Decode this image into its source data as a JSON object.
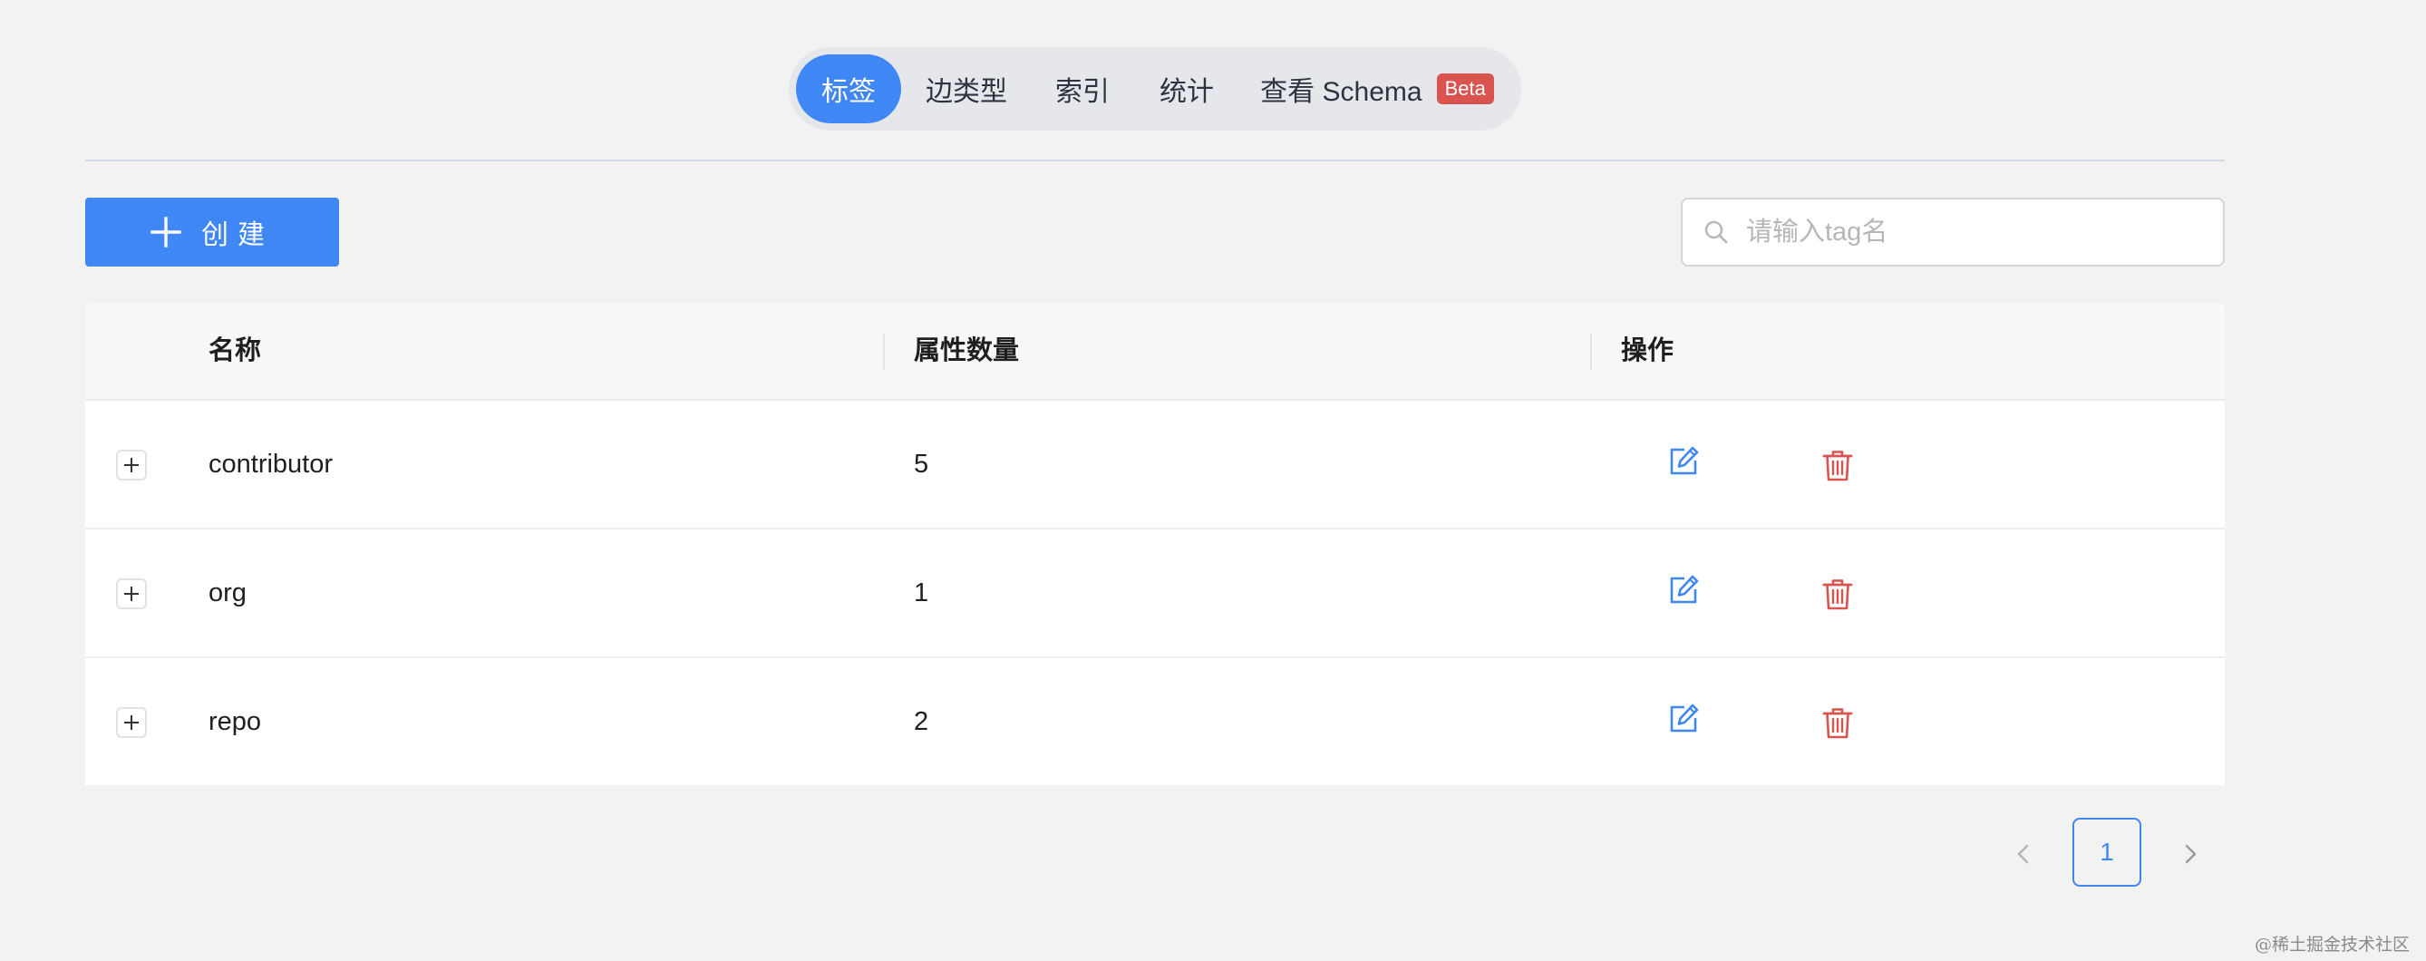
{
  "tabs": [
    {
      "label": "标签",
      "active": true
    },
    {
      "label": "边类型",
      "active": false
    },
    {
      "label": "索引",
      "active": false
    },
    {
      "label": "统计",
      "active": false
    },
    {
      "label": "查看 Schema",
      "badge": "Beta",
      "active": false
    }
  ],
  "toolbar": {
    "create_label": "创建",
    "search_placeholder": "请输入tag名",
    "search_value": ""
  },
  "table": {
    "headers": {
      "name": "名称",
      "count": "属性数量",
      "ops": "操作"
    },
    "rows": [
      {
        "name": "contributor",
        "count": "5"
      },
      {
        "name": "org",
        "count": "1"
      },
      {
        "name": "repo",
        "count": "2"
      }
    ]
  },
  "pagination": {
    "current_page": "1"
  },
  "watermark": "@稀土掘金技术社区",
  "colors": {
    "primary": "#3f87f5",
    "danger": "#d9534f",
    "background": "#f2f2f3"
  },
  "icons": {
    "create": "plus-icon",
    "search": "search-icon",
    "expand": "expand-plus-icon",
    "edit": "edit-icon",
    "delete": "trash-icon",
    "prev": "chevron-left-icon",
    "next": "chevron-right-icon"
  }
}
